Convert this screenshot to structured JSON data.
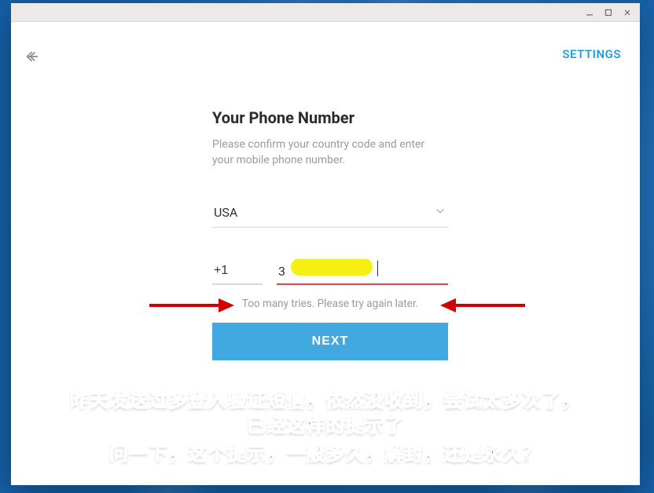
{
  "header": {
    "settings_label": "SETTINGS"
  },
  "form": {
    "heading": "Your Phone Number",
    "subtext": "Please confirm your country code and enter your mobile phone number.",
    "country_label": "USA",
    "country_code": "+1",
    "phone_prefix": "3",
    "error_message": "Too many tries. Please try again later.",
    "next_label": "NEXT"
  },
  "annotations": {
    "line1": "昨天发送过多登入验证短信，依然没收到，尝试太多次了，",
    "line2": "已经这样的提示了",
    "line3": "问一下，这个提示，一般多久，解封，还是永久？"
  }
}
